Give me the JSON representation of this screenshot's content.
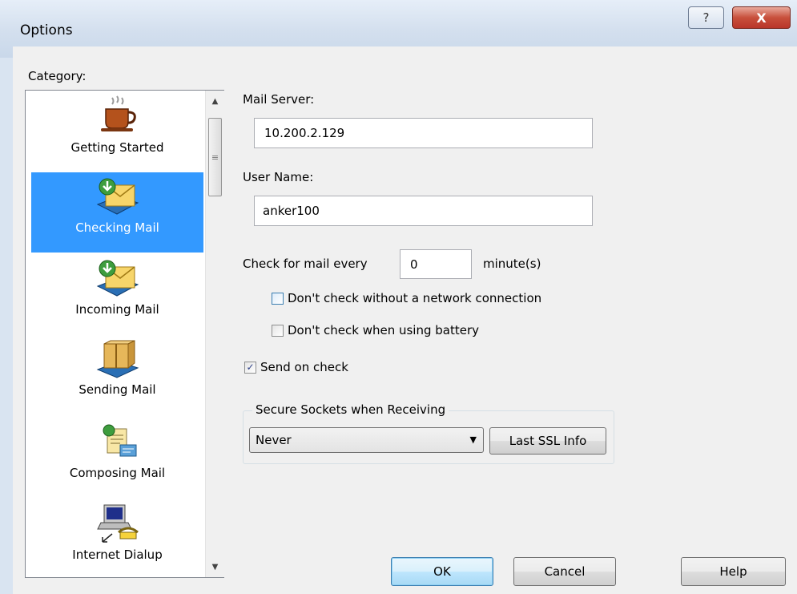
{
  "window": {
    "title": "Options",
    "help_glyph": "?",
    "close_glyph": "X"
  },
  "category": {
    "label": "Category:",
    "items": [
      {
        "label": "Getting Started",
        "icon": "coffee-cup-icon",
        "selected": false
      },
      {
        "label": "Checking Mail",
        "icon": "check-mail-envelope-icon",
        "selected": true
      },
      {
        "label": "Incoming Mail",
        "icon": "incoming-mail-envelope-icon",
        "selected": false
      },
      {
        "label": "Sending Mail",
        "icon": "sending-mail-package-icon",
        "selected": false
      },
      {
        "label": "Composing Mail",
        "icon": "composing-mail-document-icon",
        "selected": false
      },
      {
        "label": "Internet Dialup",
        "icon": "dialup-computer-phone-icon",
        "selected": false
      }
    ],
    "scroll_glyphs": {
      "up": "▲",
      "thumb": "≡",
      "down": "▼"
    }
  },
  "form": {
    "mail_server_label": "Mail Server:",
    "mail_server_value": "10.200.2.129",
    "user_name_label": "User Name:",
    "user_name_value": "anker100",
    "check_every_label": "Check for mail every",
    "check_every_value": "0",
    "check_every_unit": "minute(s)",
    "no_network_label": "Don't check without a network connection",
    "no_network_checked": false,
    "battery_label": "Don't check when using battery",
    "battery_checked": false,
    "send_on_check_label": "Send on check",
    "send_on_check_checked": true,
    "checkmark_glyph": "✓"
  },
  "ssl": {
    "group_title": "Secure Sockets when Receiving",
    "selected": "Never",
    "dropdown_glyph": "▼",
    "info_button": "Last SSL Info"
  },
  "buttons": {
    "ok": "OK",
    "cancel": "Cancel",
    "help": "Help"
  },
  "colors": {
    "selection": "#3399ff",
    "close_button": "#c8503c",
    "dialog_background": "#f0f0f0"
  }
}
